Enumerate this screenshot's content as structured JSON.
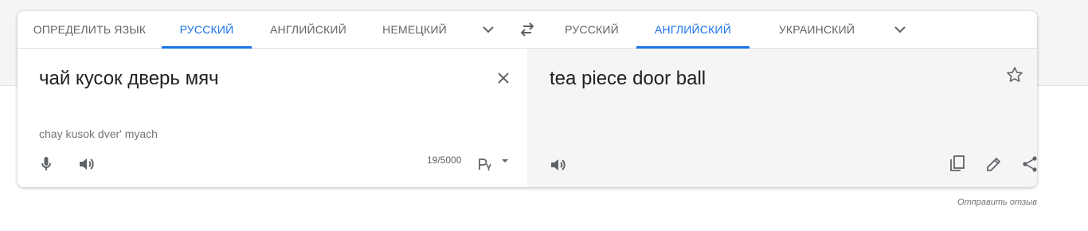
{
  "source_tabs": [
    {
      "label": "ОПРЕДЕЛИТЬ ЯЗЫК",
      "active": false
    },
    {
      "label": "РУССКИЙ",
      "active": true
    },
    {
      "label": "АНГЛИЙСКИЙ",
      "active": false
    },
    {
      "label": "НЕМЕЦКИЙ",
      "active": false
    }
  ],
  "target_tabs": [
    {
      "label": "РУССКИЙ",
      "active": false
    },
    {
      "label": "АНГЛИЙСКИЙ",
      "active": true
    },
    {
      "label": "УКРАИНСКИЙ",
      "active": false
    }
  ],
  "source": {
    "text": "чай кусок дверь мяч",
    "transliteration": "chay kusok dver' myach",
    "char_count": "19/5000"
  },
  "target": {
    "text": "tea piece door ball"
  },
  "feedback_label": "Отправить отзыв",
  "icons": {
    "source_more": "chevron-down-icon",
    "swap": "swap-arrows-icon",
    "target_more": "chevron-down-icon",
    "clear": "close-icon",
    "mic": "microphone-icon",
    "listen_source": "speaker-icon",
    "keyboard": "keyboard-layout-icon",
    "star": "star-icon",
    "listen_target": "speaker-icon",
    "copy": "copy-icon",
    "edit": "pencil-icon",
    "share": "share-icon"
  },
  "colors": {
    "accent": "#1a73e8",
    "text": "#202124",
    "muted": "#5f6368",
    "target_bg": "#f5f5f5"
  }
}
